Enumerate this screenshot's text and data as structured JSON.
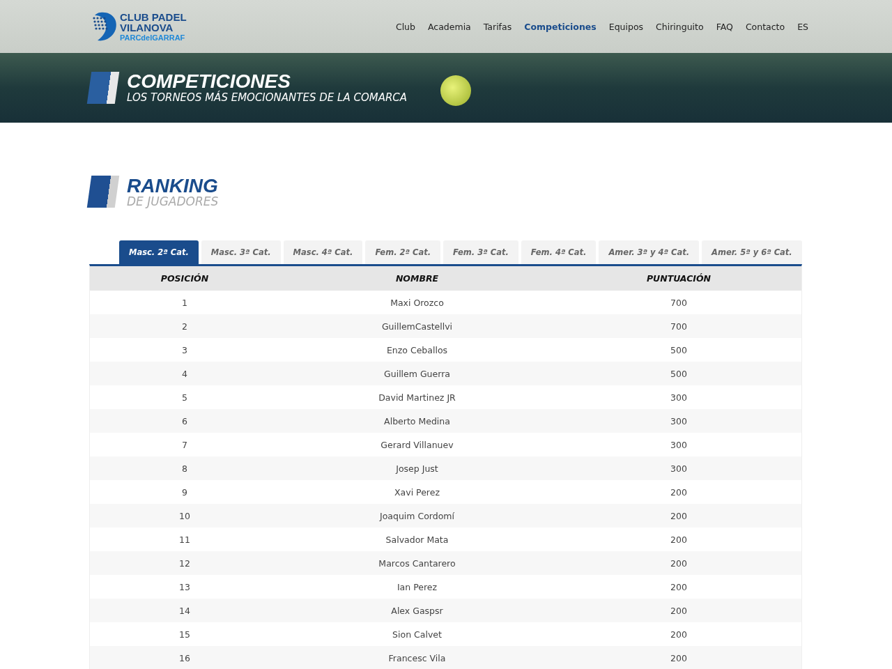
{
  "logo": {
    "line_1": "CLUB PADEL",
    "line_2": "VILANOVA",
    "line_3": "PARCdelGARRAF"
  },
  "nav": [
    {
      "label": "Club",
      "selected": false
    },
    {
      "label": "Academia",
      "selected": false
    },
    {
      "label": "Tarifas",
      "selected": false
    },
    {
      "label": "Competiciones",
      "selected": true
    },
    {
      "label": "Equipos",
      "selected": false
    },
    {
      "label": "Chiringuito",
      "selected": false
    },
    {
      "label": "FAQ",
      "selected": false
    },
    {
      "label": "Contacto",
      "selected": false
    },
    {
      "label": "ES",
      "selected": false
    }
  ],
  "hero": {
    "title": "COMPETICIONES",
    "subtitle": "LOS TORNEOS MÁS EMOCIONANTES DE LA COMARCA"
  },
  "section": {
    "title": "RANKING",
    "subtitle": "DE JUGADORES"
  },
  "tabs": [
    {
      "label": "Masc. 2ª Cat.",
      "selected": true
    },
    {
      "label": "Masc. 3ª Cat.",
      "selected": false
    },
    {
      "label": "Masc. 4ª Cat.",
      "selected": false
    },
    {
      "label": "Fem. 2ª Cat.",
      "selected": false
    },
    {
      "label": "Fem. 3ª Cat.",
      "selected": false
    },
    {
      "label": "Fem. 4ª Cat.",
      "selected": false
    },
    {
      "label": "Amer. 3ª y 4ª Cat.",
      "selected": false
    },
    {
      "label": "Amer. 5ª y 6ª Cat.",
      "selected": false
    }
  ],
  "table": {
    "columns": [
      "POSICIÓN",
      "NOMBRE",
      "PUNTUACIÓN"
    ],
    "rows": [
      [
        "1",
        "Maxi Orozco",
        "700"
      ],
      [
        "2",
        "GuillemCastellvi",
        "700"
      ],
      [
        "3",
        "Enzo Ceballos",
        "500"
      ],
      [
        "4",
        "Guillem Guerra",
        "500"
      ],
      [
        "5",
        "David Martinez JR",
        "300"
      ],
      [
        "6",
        "Alberto Medina",
        "300"
      ],
      [
        "7",
        "Gerard Villanuev",
        "300"
      ],
      [
        "8",
        "Josep Just",
        "300"
      ],
      [
        "9",
        "Xavi Perez",
        "200"
      ],
      [
        "10",
        "Joaquim Cordomí",
        "200"
      ],
      [
        "11",
        "Salvador Mata",
        "200"
      ],
      [
        "12",
        "Marcos Cantarero",
        "200"
      ],
      [
        "13",
        "Ian Perez",
        "200"
      ],
      [
        "14",
        "Alex Gaspsr",
        "200"
      ],
      [
        "15",
        "Sion Calvet",
        "200"
      ],
      [
        "16",
        "Francesc Vila",
        "200"
      ]
    ]
  }
}
